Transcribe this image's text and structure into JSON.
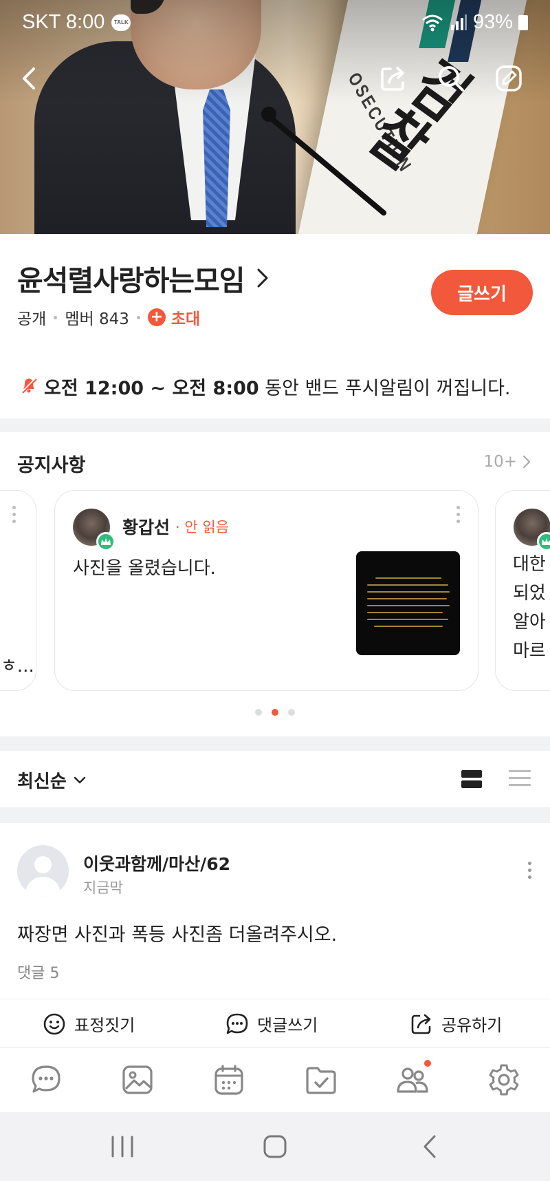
{
  "status_bar": {
    "carrier_time": "SKT 8:00",
    "talk_badge": "TALK",
    "battery": "93%"
  },
  "hero": {
    "flag_text": "OSECUTION",
    "flag_big_text": "검찰"
  },
  "band": {
    "name": "윤석렬사랑하는모임",
    "visibility": "공개",
    "members_label": "멤버 843",
    "invite_label": "초대",
    "write_label": "글쓰기"
  },
  "push_notice": {
    "time_range": "오전 12:00 ~ 오전 8:00",
    "suffix": " 동안 밴드 푸시알림이 꺼집니다."
  },
  "notices": {
    "title": "공지사항",
    "count": "10+",
    "card": {
      "author": "황갑선",
      "status": "· 안 읽음",
      "text": "사진을 올렸습니다."
    },
    "left_card_tail": "ㅎ...",
    "right_card_lines": [
      "대한",
      "되었",
      "알아",
      "마르"
    ],
    "page_index": 1,
    "page_count": 3
  },
  "sort": {
    "label": "최신순"
  },
  "post": {
    "author": "이웃과함께/마산/62",
    "time": "지금막",
    "content": "짜장면 사진과 폭등 사진좀 더올려주시오.",
    "comments": "댓글 5",
    "actions": {
      "emotion": "표정짓기",
      "comment": "댓글쓰기",
      "share": "공유하기"
    }
  },
  "tabs": [
    "chat-icon",
    "photo-icon",
    "calendar-icon",
    "folder-check-icon",
    "members-icon",
    "settings-icon"
  ],
  "colors": {
    "accent": "#f2583b",
    "crown": "#2ebd7a"
  }
}
